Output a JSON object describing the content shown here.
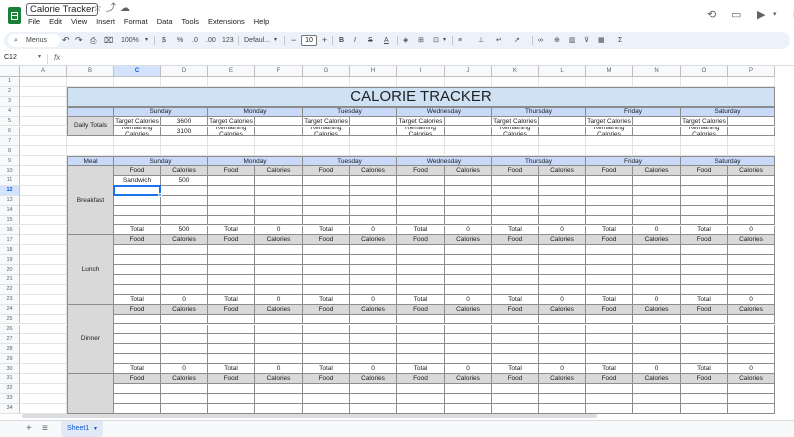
{
  "window": {
    "doc_title": "Calorie Tracker",
    "menus": [
      "File",
      "Edit",
      "View",
      "Insert",
      "Format",
      "Data",
      "Tools",
      "Extensions",
      "Help"
    ]
  },
  "toolbar": {
    "menus_label": "Menus",
    "zoom": "100%",
    "currency": "$",
    "percent": "%",
    "dec_decrease": ".0",
    "dec_increase": ".00",
    "number_format": "123",
    "font": "Defaul...",
    "font_size": "10",
    "minus": "−",
    "plus": "+",
    "bold": "B"
  },
  "formula_bar": {
    "name_box": "C12",
    "fx": "fx",
    "value": ""
  },
  "grid": {
    "columns": [
      "A",
      "B",
      "C",
      "D",
      "E",
      "F",
      "G",
      "H",
      "I",
      "J",
      "K",
      "L",
      "M",
      "N",
      "O",
      "P"
    ],
    "rows": [
      "1",
      "2",
      "3",
      "4",
      "5",
      "6",
      "7",
      "8",
      "9",
      "10",
      "11",
      "12",
      "13",
      "14",
      "15",
      "16",
      "17",
      "18",
      "19",
      "20",
      "21",
      "22",
      "23",
      "24",
      "25",
      "26",
      "27",
      "28",
      "29",
      "30",
      "31",
      "32",
      "33",
      "34"
    ],
    "selected_cell": "C12"
  },
  "sheet": {
    "title": "CALORIE TRACKER",
    "days": [
      "Sunday",
      "Monday",
      "Tuesday",
      "Wednesday",
      "Thursday",
      "Friday",
      "Saturday"
    ],
    "daily_totals_label": "Daily Totals",
    "target_label": "Target Calories",
    "remaining_label": "Remaining Calories",
    "sunday_target": "3600",
    "sunday_remaining": "3100",
    "meal_label": "Meal",
    "food_label": "Food",
    "calories_label": "Calories",
    "total_label": "Total",
    "zero": "0",
    "meals": [
      "Breakfast",
      "Lunch",
      "Dinner"
    ],
    "breakfast_entry_food": "Sandwich",
    "breakfast_entry_cal": "500",
    "breakfast_sunday_total": "500"
  },
  "tabs": {
    "active": "Sheet1"
  }
}
